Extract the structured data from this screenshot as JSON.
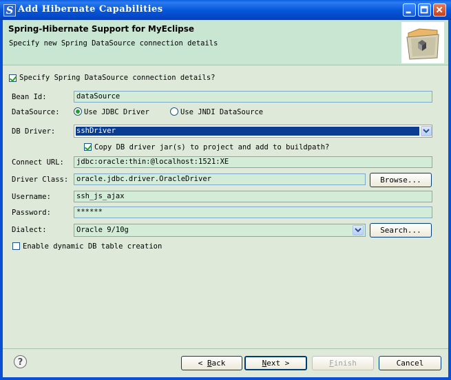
{
  "window": {
    "title": "Add Hibernate Capabilities",
    "icon": "myeclipse-s-icon"
  },
  "banner": {
    "title": "Spring-Hibernate Support for MyEclipse",
    "description": "Specify new Spring DataSource connection details",
    "image": "folder-with-package-icon"
  },
  "form": {
    "specify_checkbox": {
      "label": "Specify Spring DataSource connection details?",
      "checked": true
    },
    "bean_id": {
      "label": "Bean Id:",
      "value": "dataSource"
    },
    "datasource": {
      "label": "DataSource:",
      "options": [
        {
          "label": "Use JDBC Driver",
          "selected": true
        },
        {
          "label": "Use JNDI DataSource",
          "selected": false
        }
      ]
    },
    "db_driver": {
      "label": "DB Driver:",
      "value": "sshDriver"
    },
    "copy_jar": {
      "label": "Copy DB driver jar(s) to project and add to buildpath?",
      "checked": true
    },
    "connect_url": {
      "label": "Connect URL:",
      "value": "jdbc:oracle:thin:@localhost:1521:XE"
    },
    "driver_class": {
      "label": "Driver Class:",
      "value": "oracle.jdbc.driver.OracleDriver",
      "button": "Browse..."
    },
    "username": {
      "label": "Username:",
      "value": "ssh_js_ajax"
    },
    "password": {
      "label": "Password:",
      "value": "******"
    },
    "dialect": {
      "label": "Dialect:",
      "value": "Oracle 9/10g",
      "button": "Search..."
    },
    "dynamic_table": {
      "label": "Enable dynamic DB table creation",
      "checked": false
    }
  },
  "footer": {
    "help": "?",
    "back_pre": "< ",
    "back_key": "B",
    "back_rest": "ack",
    "next_key": "N",
    "next_rest": "ext >",
    "finish_key": "F",
    "finish_rest": "inish",
    "cancel": "Cancel"
  },
  "colors": {
    "titlebar": "#0758d9",
    "banner": "#c9e6d3",
    "body": "#dfe9d9",
    "field": "#d2ecd8",
    "selection": "#0a3d91",
    "check": "#21a121"
  }
}
